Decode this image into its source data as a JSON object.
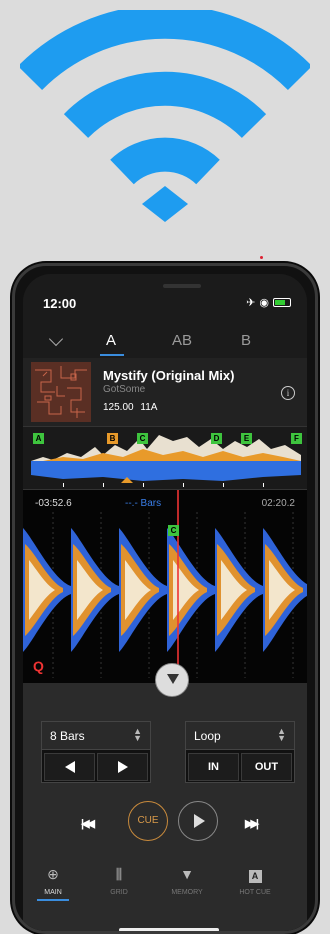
{
  "colors": {
    "wifi": "#1e9cf0",
    "accent": "#3a8dde",
    "cue": "#d99a4a",
    "playhead": "#e33",
    "hotcue_green": "#3ec43e",
    "hotcue_orange": "#e89a2a"
  },
  "status": {
    "time": "12:00",
    "icons": [
      "airplane-icon",
      "wifi-icon",
      "battery-icon"
    ]
  },
  "deck_tabs": [
    "A",
    "AB",
    "B"
  ],
  "track": {
    "title": "Mystify (Original Mix)",
    "artist": "GotSome",
    "bpm": "125.00",
    "key": "11A"
  },
  "hot_cues": [
    "A",
    "B",
    "C",
    "D",
    "E",
    "F"
  ],
  "waveform": {
    "time_left": "-03:52.6",
    "bars": "--.- Bars",
    "time_right": "02:20.2",
    "grid_cue": "C",
    "quantize": "Q"
  },
  "loop_panel": {
    "beat_select": "8 Bars",
    "loop_select": "Loop",
    "in": "IN",
    "out": "OUT"
  },
  "transport": {
    "cue": "CUE"
  },
  "nav": [
    {
      "label": "MAIN",
      "icon": "globe-icon"
    },
    {
      "label": "GRID",
      "icon": "grid-icon"
    },
    {
      "label": "MEMORY",
      "icon": "memory-icon"
    },
    {
      "label": "HOT CUE",
      "icon": "hotcue-icon"
    }
  ]
}
